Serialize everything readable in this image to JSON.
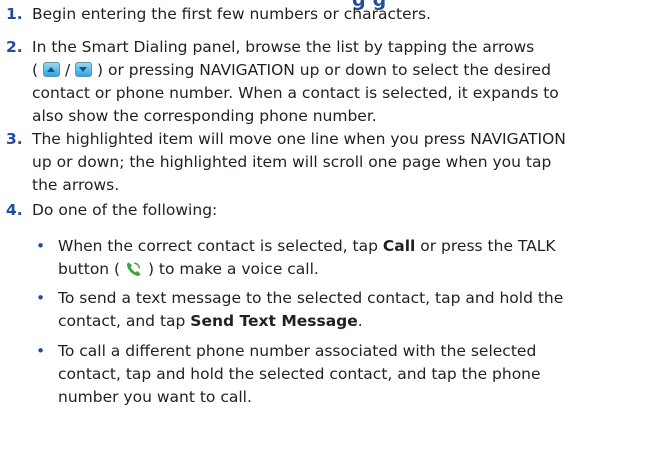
{
  "heading_fragment": "g g",
  "steps": [
    {
      "num": "1.",
      "text": "Begin entering the first few numbers or characters."
    },
    {
      "num": "2.",
      "line1": "In the Smart Dialing panel, browse the list by tapping the arrows",
      "paren_open": "(",
      "slash": "/",
      "after_arrows": ") or pressing NAVIGATION up or down to select the desired",
      "line3": "contact or phone number. When a contact is selected, it expands to",
      "line4": "also show the corresponding phone number.",
      "icons": [
        "arrow-up-icon",
        "arrow-down-icon"
      ]
    },
    {
      "num": "3.",
      "line1": "The highlighted item will move one line when you press NAVIGATION",
      "line2": "up or down; the highlighted item will scroll one page when you tap",
      "line3": "the arrows."
    },
    {
      "num": "4.",
      "text": "Do one of the following:",
      "bullets": [
        {
          "pre": "When the correct contact is selected, tap ",
          "bold": "Call",
          "post": " or press the TALK",
          "line2_pre": "button ( ",
          "line2_post": " ) to make a voice call.",
          "icon": "phone-icon"
        },
        {
          "line1": "To send a text message to the selected contact, tap and hold the",
          "line2_pre": "contact, and tap ",
          "bold": "Send Text Message",
          "line2_post": "."
        },
        {
          "line1": "To call a different phone number associated with the selected",
          "line2": "contact, tap and hold the selected contact, and tap the phone",
          "line3": "number you want to call."
        }
      ]
    }
  ],
  "colors": {
    "accent": "#1f4e9c",
    "text": "#231f20",
    "phone": "#3aa53a"
  }
}
